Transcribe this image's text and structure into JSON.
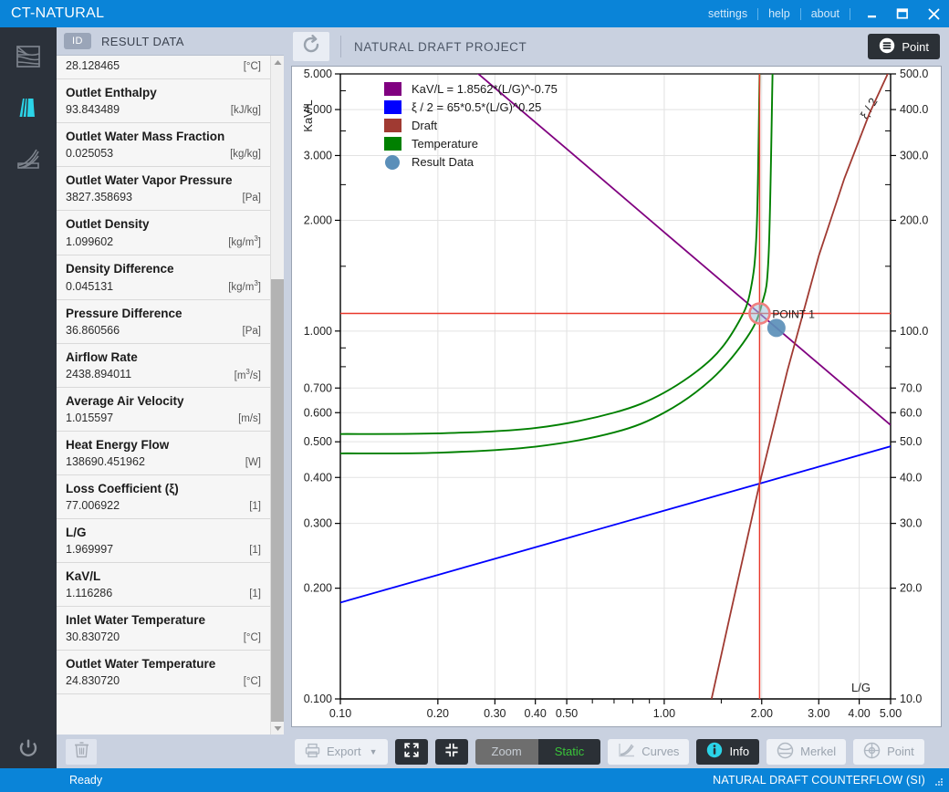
{
  "titlebar": {
    "app_title": "CT-NATURAL",
    "links": [
      "settings",
      "help",
      "about"
    ],
    "minimize_icon": "minimize-icon",
    "maximize_icon": "maximize-icon",
    "close_icon": "close-icon"
  },
  "rail": {
    "items": [
      {
        "name": "sidebar-item-crossflow",
        "icon": "crossflow-tower-icon",
        "selected": false
      },
      {
        "name": "sidebar-item-natural-draft",
        "icon": "natural-draft-tower-icon",
        "selected": true
      },
      {
        "name": "sidebar-item-curves",
        "icon": "fan-curve-icon",
        "selected": false
      }
    ],
    "power": {
      "name": "power-button",
      "icon": "power-icon"
    }
  },
  "results": {
    "id_badge": "ID",
    "header_title": "RESULT DATA",
    "rows": [
      {
        "label": "",
        "value": "28.128465",
        "unit": "[°C]",
        "partial": true
      },
      {
        "label": "Outlet Enthalpy",
        "value": "93.843489",
        "unit": "[kJ/kg]"
      },
      {
        "label": "Outlet Water Mass Fraction",
        "value": "0.025053",
        "unit": "[kg/kg]"
      },
      {
        "label": "Outlet Water Vapor Pressure",
        "value": "3827.358693",
        "unit": "[Pa]"
      },
      {
        "label": "Outlet Density",
        "value": "1.099602",
        "unit": "[kg/m³]"
      },
      {
        "label": "Density Difference",
        "value": "0.045131",
        "unit": "[kg/m³]"
      },
      {
        "label": "Pressure Difference",
        "value": "36.860566",
        "unit": "[Pa]"
      },
      {
        "label": "Airflow Rate",
        "value": "2438.894011",
        "unit": "[m³/s]"
      },
      {
        "label": "Average Air Velocity",
        "value": "1.015597",
        "unit": "[m/s]"
      },
      {
        "label": "Heat Energy Flow",
        "value": "138690.451962",
        "unit": "[W]"
      },
      {
        "label": "Loss Coefficient (ξ)",
        "value": "77.006922",
        "unit": "[1]"
      },
      {
        "label": "L/G",
        "value": "1.969997",
        "unit": "[1]"
      },
      {
        "label": "KaV/L",
        "value": "1.116286",
        "unit": "[1]"
      },
      {
        "label": "Inlet Water Temperature",
        "value": "30.830720",
        "unit": "[°C]"
      },
      {
        "label": "Outlet Water Temperature",
        "value": "24.830720",
        "unit": "[°C]"
      }
    ],
    "delete_button": "trash-icon"
  },
  "chart_toolbar": {
    "refresh_icon": "refresh-icon",
    "project_title": "NATURAL DRAFT PROJECT",
    "point_button_label": "Point",
    "point_button_icon": "list-icon"
  },
  "bottom_toolbar": {
    "export_label": "Export",
    "export_icon": "printer-icon",
    "expand_icon": "expand-icon",
    "collapse_icon": "collapse-icon",
    "zoom_label": "Zoom",
    "static_label": "Static",
    "curves_label": "Curves",
    "curves_icon": "curves-icon",
    "info_label": "Info",
    "info_icon": "info-icon",
    "merkel_label": "Merkel",
    "merkel_icon": "merkel-icon",
    "point_label": "Point",
    "point_icon": "target-icon"
  },
  "statusbar": {
    "left": "Ready",
    "right": "NATURAL DRAFT COUNTERFLOW (SI)"
  },
  "chart_data": {
    "type": "line",
    "title": "",
    "xlabel": "L/G",
    "ylabel": "KaV/L",
    "y2label": "ξ / 2",
    "xscale": "log",
    "yscale": "log",
    "xlim": [
      0.1,
      5.0
    ],
    "ylim": [
      0.1,
      5.0
    ],
    "y2lim": [
      10.0,
      500.0
    ],
    "grid": true,
    "xticks": [
      "0.10",
      "0.20",
      "0.30",
      "0.40",
      "0.50",
      "1.00",
      "2.00",
      "3.00",
      "4.00",
      "5.00"
    ],
    "xtick_values": [
      0.1,
      0.2,
      0.3,
      0.4,
      0.5,
      1.0,
      2.0,
      3.0,
      4.0,
      5.0
    ],
    "yticks": [
      "5.000",
      "4.000",
      "3.000",
      "2.000",
      "1.000",
      "0.700",
      "0.600",
      "0.500",
      "0.400",
      "0.300",
      "0.200",
      "0.100"
    ],
    "ytick_values": [
      5.0,
      4.0,
      3.0,
      2.0,
      1.0,
      0.7,
      0.6,
      0.5,
      0.4,
      0.3,
      0.2,
      0.1
    ],
    "y2ticks": [
      "500.0",
      "400.0",
      "300.0",
      "200.0",
      "100.0",
      "70.0",
      "60.0",
      "50.0",
      "40.0",
      "30.0",
      "20.0",
      "10.0"
    ],
    "y2tick_values": [
      500,
      400,
      300,
      200,
      100,
      70,
      60,
      50,
      40,
      30,
      20,
      10
    ],
    "legend_position": "top-left",
    "legend": [
      {
        "label": "KaV/L = 1.8562*(L/G)^-0.75",
        "color": "#800080",
        "marker": "square"
      },
      {
        "label": "ξ / 2 = 65*0.5*(L/G)^0.25",
        "color": "#0000ff",
        "marker": "square"
      },
      {
        "label": "Draft",
        "color": "#a03a32",
        "marker": "square"
      },
      {
        "label": "Temperature",
        "color": "#008000",
        "marker": "square"
      },
      {
        "label": "Result Data",
        "color": "#5b8fb9",
        "marker": "circle"
      }
    ],
    "series": [
      {
        "name": "KaV/L = 1.8562*(L/G)^-0.75",
        "color": "#800080",
        "axis": "left",
        "equation": "1.8562*x^-0.75",
        "x": [
          0.1,
          0.2,
          0.3,
          0.5,
          1.0,
          1.97,
          3.0,
          5.0
        ],
        "values": [
          10.437,
          6.207,
          4.578,
          3.127,
          1.8562,
          1.1163,
          0.8139,
          0.5553
        ]
      },
      {
        "name": "ξ / 2 = 65*0.5*(L/G)^0.25",
        "color": "#0000ff",
        "axis": "right",
        "equation": "32.5*x^0.25",
        "x": [
          0.1,
          0.2,
          0.3,
          0.5,
          1.0,
          1.97,
          3.0,
          5.0
        ],
        "values": [
          18.28,
          21.73,
          24.05,
          27.33,
          32.5,
          38.5,
          42.77,
          48.6
        ]
      },
      {
        "name": "Draft",
        "color": "#a03a32",
        "axis": "right",
        "x": [
          1.4,
          1.6,
          1.97,
          2.4,
          3.0,
          3.6,
          4.3,
          5.0
        ],
        "values": [
          10.0,
          17.0,
          38.5,
          78.0,
          160.0,
          260.0,
          390.0,
          520.0
        ]
      },
      {
        "name": "Temperature (upper)",
        "color": "#008000",
        "axis": "left",
        "x": [
          0.1,
          0.2,
          0.4,
          0.7,
          1.0,
          1.4,
          1.7,
          1.85,
          1.93,
          1.97
        ],
        "values": [
          0.525,
          0.527,
          0.545,
          0.6,
          0.68,
          0.84,
          1.06,
          1.3,
          1.9,
          5.0
        ]
      },
      {
        "name": "Temperature (lower)",
        "color": "#008000",
        "axis": "left",
        "x": [
          0.1,
          0.2,
          0.4,
          0.7,
          1.0,
          1.4,
          1.8,
          2.0,
          2.1,
          2.16
        ],
        "values": [
          0.465,
          0.467,
          0.485,
          0.53,
          0.6,
          0.74,
          0.96,
          1.18,
          1.6,
          5.0
        ]
      }
    ],
    "crosshair": {
      "x": 1.969997,
      "y": 1.116286,
      "color": "#e8382b"
    },
    "markers": [
      {
        "name": "POINT 1",
        "label": "POINT 1",
        "x": 1.969997,
        "y": 1.116286,
        "type": "ring",
        "color": "#f08080"
      },
      {
        "name": "Result Data",
        "label": "",
        "x": 2.22,
        "y": 1.02,
        "type": "dot",
        "color": "#5b8fb9"
      }
    ]
  }
}
